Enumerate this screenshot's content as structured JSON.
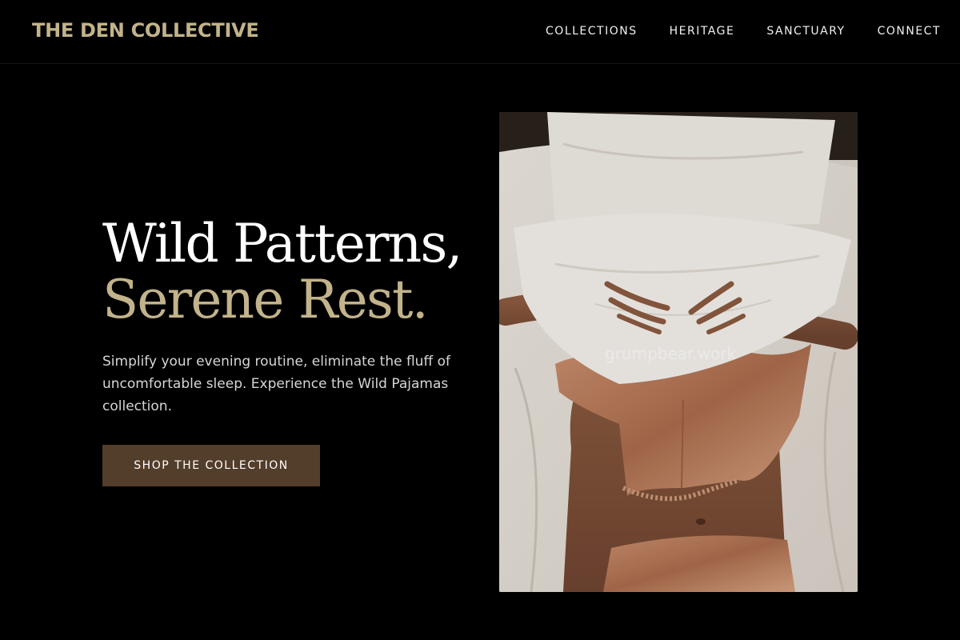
{
  "header": {
    "brand": "THE DEN COLLECTIVE",
    "nav": [
      {
        "label": "COLLECTIONS"
      },
      {
        "label": "HERITAGE"
      },
      {
        "label": "SANCTUARY"
      },
      {
        "label": "CONNECT"
      }
    ]
  },
  "hero": {
    "headline_line1": "Wild Patterns,",
    "headline_line2": "Serene Rest.",
    "subtext": "Simplify your evening routine, eliminate the fluff of uncomfortable sleep. Experience the Wild Pajamas collection.",
    "cta_label": "SHOP THE COLLECTION",
    "image_watermark": "grumpbear.work"
  },
  "colors": {
    "background": "#000000",
    "accent_gold": "#c2b38a",
    "cta_brown": "#533d2b"
  }
}
